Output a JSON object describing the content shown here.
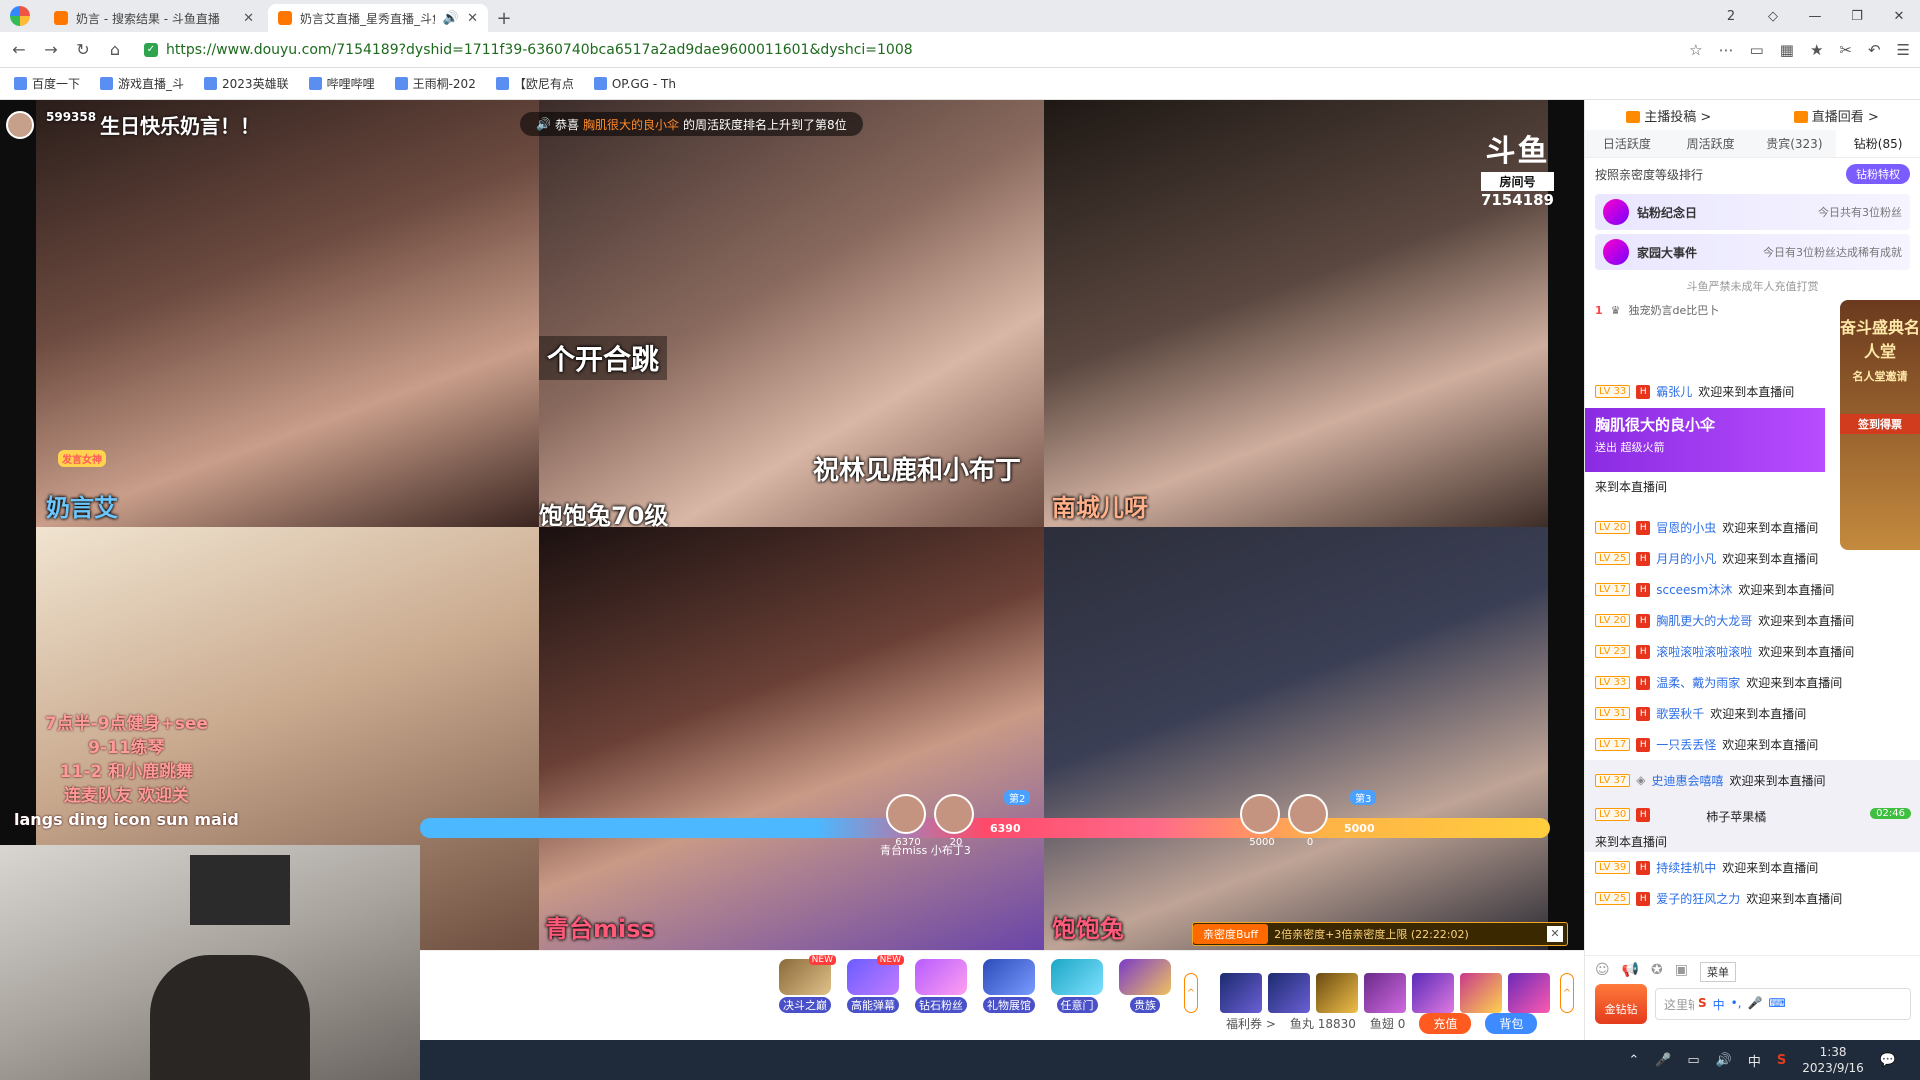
{
  "browser": {
    "tabs": [
      {
        "title": "奶言 - 搜索结果 - 斗鱼直播",
        "active": false
      },
      {
        "title": "奶言艾直播_星秀直播_斗鱼",
        "active": true
      }
    ],
    "new_tab_symbol": "+",
    "window_controls": [
      "2",
      "◇",
      "—",
      "❐",
      "—",
      "✕"
    ],
    "url": "https://www.douyu.com/7154189?dyshid=1711f39-6360740bca6517a2ad9dae9600011601&dyshci=1008",
    "bookmarks": [
      "百度一下",
      "游戏直播_斗",
      "2023英雄联",
      "哔哩哔哩",
      "王雨桐-202",
      "【欧尼有点",
      "OP.GG - Th"
    ]
  },
  "stream": {
    "top_user_count": "599358",
    "top_banner": "生日快乐奶言！！",
    "notice": {
      "prefix": "恭喜",
      "highlight": "胸肌很大的良小伞",
      "suffix": "的周活跃度排名上升到了第8位"
    },
    "room_logo": {
      "brand": "斗鱼",
      "tag": "房间号",
      "room_number": "7154189"
    },
    "cells": [
      {
        "caption": "奶言艾",
        "subcaption": "发言女神"
      },
      {
        "caption": "个开合跳",
        "subcaption": "祝林见鹿和小布丁"
      },
      {
        "caption": "南城儿呀",
        "subcaption": ""
      },
      {
        "caption": "",
        "subcaption": "饱饱兔70级"
      },
      {
        "caption": "青台miss",
        "subcaption": ""
      },
      {
        "caption": "饱饱兔",
        "subcaption": ""
      }
    ],
    "schedule_lines": [
      "7点半-9点健身+see",
      "9-11练琴",
      "11-2 和小鹿跳舞",
      "连麦队友 欢迎关",
      "langs ding icon sun maid"
    ],
    "pk": {
      "left_scores": [
        "6370",
        "20"
      ],
      "left_total": "6390",
      "left_rank": "第2",
      "left_names": "青台miss  小布丁3",
      "right_scores": [
        "5000",
        "0"
      ],
      "right_total": "5000",
      "right_rank": "第3"
    },
    "buff": {
      "label": "亲密度Buff",
      "text": "2倍亲密度+3倍亲密度上限 (22:22:02)",
      "close": "✕"
    }
  },
  "gift_bar": {
    "gifts": [
      {
        "name": "决斗之巅",
        "new": true
      },
      {
        "name": "高能弹幕",
        "new": true
      },
      {
        "name": "钻石粉丝",
        "new": false
      },
      {
        "name": "礼物展馆",
        "new": false
      },
      {
        "name": "任意门",
        "new": false
      },
      {
        "name": "贵族",
        "new": false
      }
    ],
    "new_badge": "NEW",
    "expand_symbol": "^",
    "prop_count": 7,
    "welfare": "福利券 >",
    "yuwan": "鱼丸 18830",
    "yuchi": "鱼翅 0",
    "recharge": "充值",
    "backpack": "背包"
  },
  "sidebar": {
    "top_links": [
      "主播投稿 >",
      "直播回看 >"
    ],
    "tabs": [
      "日活跃度",
      "周活跃度",
      "贵宾(323)",
      "钻粉(85)"
    ],
    "rank_note": "按照亲密度等级排行",
    "privilege_btn": "钻粉特权",
    "banners": [
      {
        "title": "钻粉纪念日",
        "sub": "今日共有3位粉丝"
      },
      {
        "title": "家园大事件",
        "sub": "今日有3位粉丝达成稀有成就"
      }
    ],
    "warning": "斗鱼严禁未成年人充值打赏",
    "top_fan": {
      "index": "1",
      "name": "独宠奶言de比巴卜"
    },
    "gift_notice": {
      "name": "胸肌很大的良小伞",
      "sub": "送出  超级火箭"
    },
    "arrive_text": "来到本直播间",
    "hall_of_fame": {
      "title": "奋斗盛典名人堂",
      "sub": "名人堂邀请",
      "sign": "签到得票"
    },
    "messages": [
      {
        "lv": "LV 33",
        "user": "霸张儿",
        "text": "欢迎来到本直播间"
      },
      {
        "lv": "LV 20",
        "user": "冒恩的小虫",
        "text": "欢迎来到本直播间"
      },
      {
        "lv": "LV 25",
        "user": "月月的小凡",
        "text": "欢迎来到本直播间"
      },
      {
        "lv": "LV 17",
        "user": "scceesm沐沐",
        "text": "欢迎来到本直播间"
      },
      {
        "lv": "LV 20",
        "user": "胸肌更大的大龙哥",
        "text": "欢迎来到本直播间"
      },
      {
        "lv": "LV 23",
        "user": "滚啦滚啦滚啦滚啦",
        "text": "欢迎来到本直播间"
      },
      {
        "lv": "LV 33",
        "user": "温柔、戴为雨家",
        "text": "欢迎来到本直播间"
      },
      {
        "lv": "LV 31",
        "user": "歌罢秋千",
        "text": "欢迎来到本直播间"
      },
      {
        "lv": "LV 17",
        "user": "一只丢丢怪",
        "text": "欢迎来到本直播间"
      },
      {
        "lv": "LV 37",
        "user": "史迪惠会嘻嘻",
        "text": "欢迎来到本直播间"
      },
      {
        "lv": "LV 30",
        "user": "柿子苹果橘",
        "text": "来到本直播间"
      },
      {
        "lv": "LV 39",
        "user": "持续挂机中",
        "text": "欢迎来到本直播间"
      },
      {
        "lv": "LV 25",
        "user": "爱子的狂风之力",
        "text": "欢迎来到本直播间"
      }
    ],
    "timer": "02:46",
    "gold_btn": "金钻钻",
    "chat_placeholder": "这里输",
    "tooltip": "菜单",
    "ime": [
      "中",
      "•,",
      "🎤",
      "⌨"
    ]
  },
  "taskbar": {
    "time": "1:38",
    "date": "2023/9/16",
    "ime": "中"
  }
}
